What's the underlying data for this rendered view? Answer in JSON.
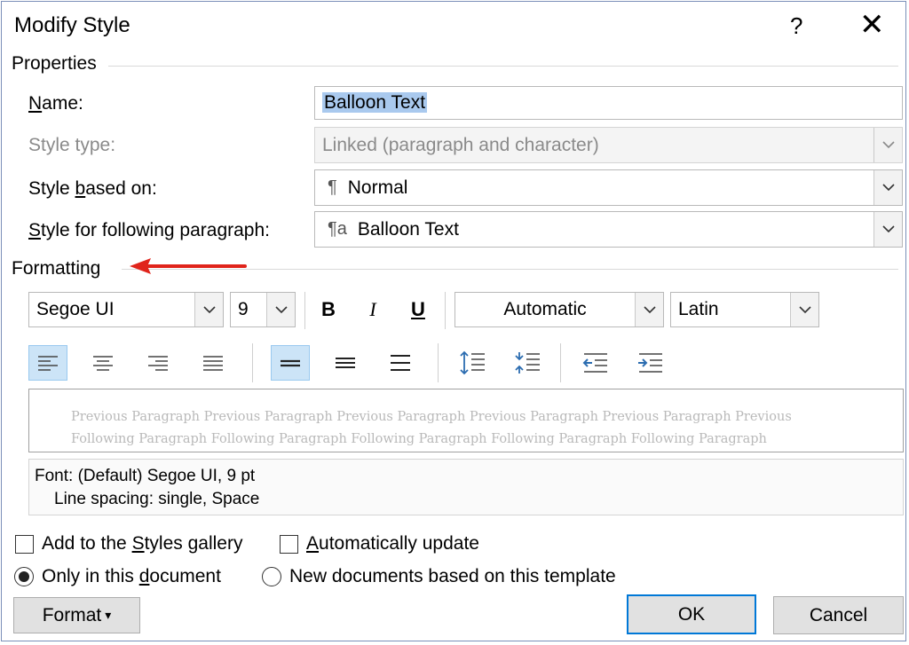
{
  "window": {
    "title": "Modify Style",
    "help_label": "?",
    "close_label": "✕"
  },
  "properties": {
    "section_label": "Properties",
    "name": {
      "label_u": "N",
      "label_rest": "ame:",
      "value": "Balloon Text"
    },
    "style_type": {
      "label": "Style type:",
      "value": "Linked (paragraph and character)"
    },
    "based_on": {
      "label_a": "Style ",
      "label_u": "b",
      "label_rest": "ased on:",
      "glyph": "¶",
      "value": "Normal"
    },
    "following": {
      "label_u": "S",
      "label_rest": "tyle for following paragraph:",
      "glyph": "¶a",
      "value": "Balloon Text"
    }
  },
  "formatting": {
    "section_label": "Formatting",
    "font": "Segoe UI",
    "size": "9",
    "bold": "B",
    "italic": "I",
    "underline": "U",
    "color": "Automatic",
    "script": "Latin",
    "accent_color": "#e0241b"
  },
  "preview": {
    "line1": "Previous Paragraph Previous Paragraph Previous Paragraph Previous Paragraph Previous Paragraph Previous",
    "line2": "Following Paragraph Following Paragraph Following Paragraph Following Paragraph Following Paragraph"
  },
  "description": {
    "line1": "Font: (Default) Segoe UI, 9 pt",
    "line2": "Line spacing:  single, Space"
  },
  "options": {
    "add_gallery": {
      "pre": "Add to the ",
      "u": "S",
      "post": "tyles gallery",
      "checked": false
    },
    "auto_update": {
      "u": "A",
      "post": "utomatically update",
      "checked": false
    },
    "only_doc": {
      "pre": "Only in this ",
      "u": "d",
      "post": "ocument",
      "selected": true
    },
    "new_docs": {
      "label": "New documents based on this template",
      "selected": false
    }
  },
  "buttons": {
    "format_pre": "Format ",
    "format_caret": "▾",
    "ok": "OK",
    "cancel": "Cancel"
  }
}
